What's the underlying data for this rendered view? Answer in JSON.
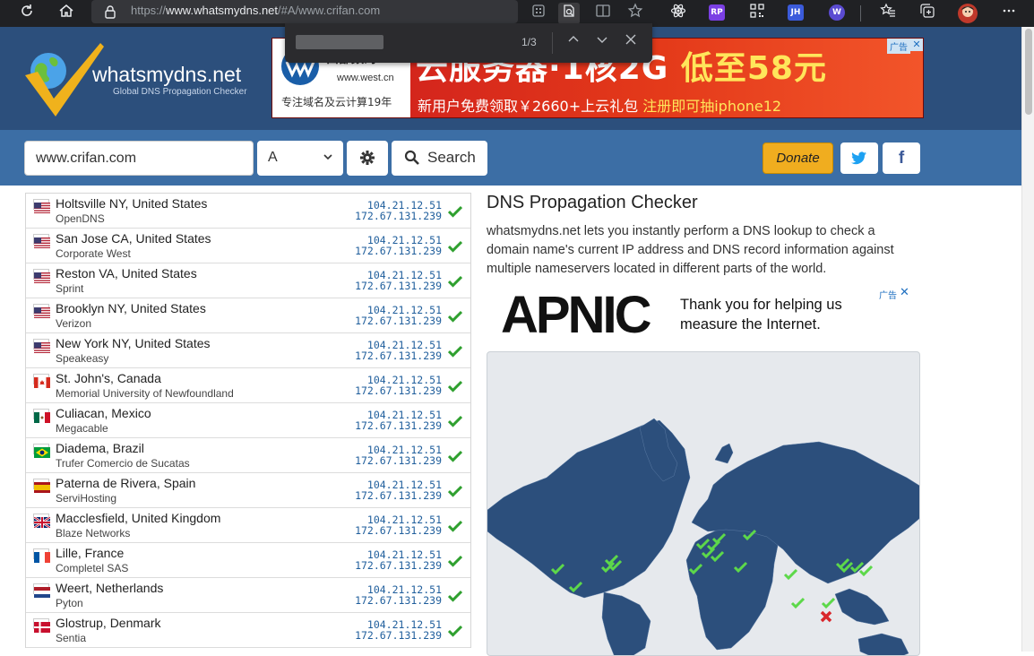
{
  "browser": {
    "url_scheme": "https://",
    "url_host": "www.whatsmydns.net",
    "url_path": "/#A/www.crifan.com",
    "find_count": "1/3",
    "icons": [
      "reload-icon",
      "home-icon",
      "lock-icon",
      "reader-icon",
      "extension-icon",
      "favorites-icon",
      "collections-icon",
      "more-icon"
    ],
    "extensions": [
      {
        "label": "RP",
        "color": "#7b3fe4"
      },
      {
        "label": "JH",
        "color": "#3b5bdb"
      },
      {
        "label": "W",
        "color": "#5b4bd1"
      }
    ]
  },
  "site": {
    "logo_text": "whatsmydns.net",
    "logo_sub": "Global DNS Propagation Checker",
    "colors": {
      "header": "#2c4f7c",
      "searchbar": "#3c6ea5",
      "donate": "#f0ad1f",
      "check": "#2fa02f",
      "fail": "#d9262c"
    }
  },
  "ad_banner": {
    "brand": "西部数码",
    "brand_url": "www.west.cn",
    "slogan": "专注域名及云计算19年",
    "main_a": "云服务器·1核2G ",
    "main_b": "低至58元",
    "sub_a": "新用户免费领取￥2660+上云礼包  ",
    "sub_b": "注册即可抽iphone12",
    "ad_tag": "广告"
  },
  "search": {
    "domain_value": "www.crifan.com",
    "record_type": "A",
    "search_label": "Search",
    "donate_label": "Donate",
    "twitter_label": "🐦",
    "facebook_label": "f"
  },
  "results": [
    {
      "city": "Holtsville NY, United States",
      "provider": "OpenDNS",
      "flag": "us",
      "ip1": "104.21.12.51",
      "ip2": "172.67.131.239",
      "status": "ok"
    },
    {
      "city": "San Jose CA, United States",
      "provider": "Corporate West",
      "flag": "us",
      "ip1": "104.21.12.51",
      "ip2": "172.67.131.239",
      "status": "ok"
    },
    {
      "city": "Reston VA, United States",
      "provider": "Sprint",
      "flag": "us",
      "ip1": "104.21.12.51",
      "ip2": "172.67.131.239",
      "status": "ok"
    },
    {
      "city": "Brooklyn NY, United States",
      "provider": "Verizon",
      "flag": "us",
      "ip1": "104.21.12.51",
      "ip2": "172.67.131.239",
      "status": "ok"
    },
    {
      "city": "New York NY, United States",
      "provider": "Speakeasy",
      "flag": "us",
      "ip1": "104.21.12.51",
      "ip2": "172.67.131.239",
      "status": "ok"
    },
    {
      "city": "St. John's, Canada",
      "provider": "Memorial University of Newfoundland",
      "flag": "ca",
      "ip1": "104.21.12.51",
      "ip2": "172.67.131.239",
      "status": "ok"
    },
    {
      "city": "Culiacan, Mexico",
      "provider": "Megacable",
      "flag": "mx",
      "ip1": "104.21.12.51",
      "ip2": "172.67.131.239",
      "status": "ok"
    },
    {
      "city": "Diadema, Brazil",
      "provider": "Trufer Comercio de Sucatas",
      "flag": "br",
      "ip1": "104.21.12.51",
      "ip2": "172.67.131.239",
      "status": "ok"
    },
    {
      "city": "Paterna de Rivera, Spain",
      "provider": "ServiHosting",
      "flag": "es",
      "ip1": "104.21.12.51",
      "ip2": "172.67.131.239",
      "status": "ok"
    },
    {
      "city": "Macclesfield, United Kingdom",
      "provider": "Blaze Networks",
      "flag": "gb",
      "ip1": "104.21.12.51",
      "ip2": "172.67.131.239",
      "status": "ok"
    },
    {
      "city": "Lille, France",
      "provider": "Completel SAS",
      "flag": "fr",
      "ip1": "104.21.12.51",
      "ip2": "172.67.131.239",
      "status": "ok"
    },
    {
      "city": "Weert, Netherlands",
      "provider": "Pyton",
      "flag": "nl",
      "ip1": "104.21.12.51",
      "ip2": "172.67.131.239",
      "status": "ok"
    },
    {
      "city": "Glostrup, Denmark",
      "provider": "Sentia",
      "flag": "dk",
      "ip1": "104.21.12.51",
      "ip2": "172.67.131.239",
      "status": "ok"
    }
  ],
  "info": {
    "title": "DNS Propagation Checker",
    "text": "whatsmydns.net lets you instantly perform a DNS lookup to check a domain name's current IP address and DNS record information against multiple nameservers located in different parts of the world."
  },
  "apnic_ad": {
    "logo": "APNIC",
    "text_line1": "Thank you for helping us",
    "text_line2": "measure the Internet.",
    "ad_tag": "广告"
  },
  "map": {
    "ocean_color": "#e6e9ed",
    "land_color": "#2c4f7c"
  }
}
